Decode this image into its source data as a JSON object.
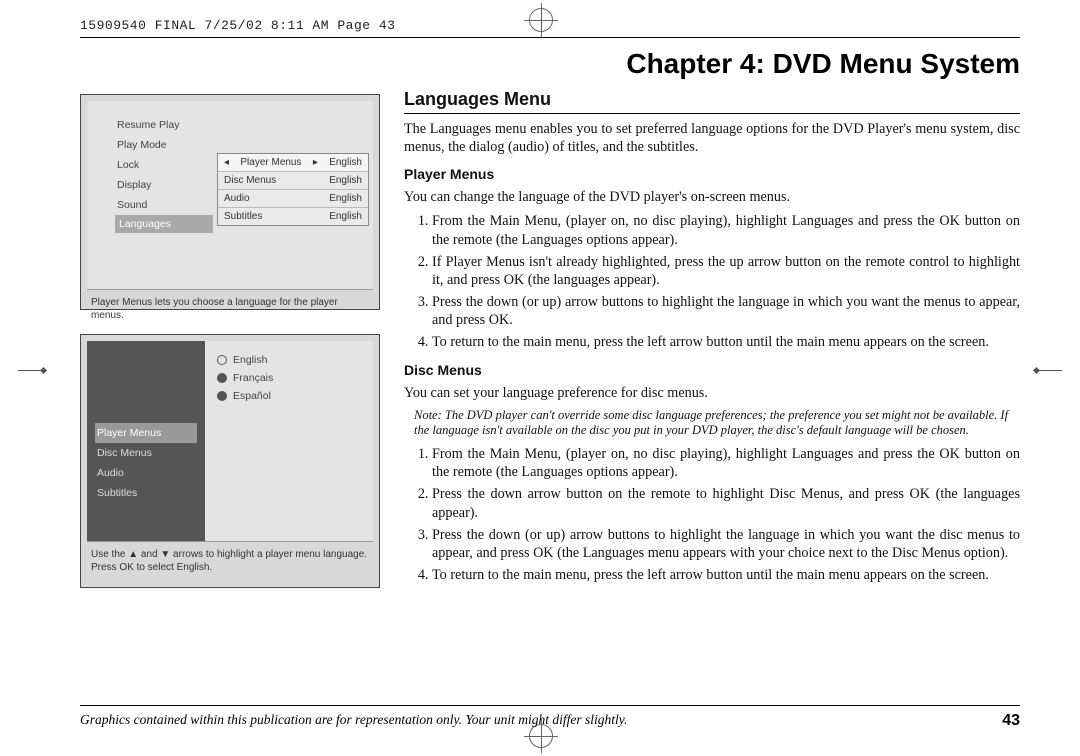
{
  "header_strip": "15909540 FINAL  7/25/02  8:11 AM  Page 43",
  "chapter_title": "Chapter 4: DVD Menu System",
  "section_title": "Languages Menu",
  "intro": "The Languages menu enables you to set preferred language options for the DVD Player's menu system, disc menus, the dialog (audio) of titles, and the subtitles.",
  "player_menus_title": "Player Menus",
  "player_menus_intro": "You can change the language of the DVD player's on-screen menus.",
  "player_steps": {
    "s1": "From the Main Menu, (player on, no disc playing), highlight Languages and press the OK button on the remote (the Languages options appear).",
    "s2": "If Player Menus isn't already highlighted, press the up arrow button on the remote control to highlight it, and press OK (the languages appear).",
    "s3": "Press the down (or up) arrow buttons to highlight the language in which you want the menus to appear, and press OK.",
    "s4": "To return to the main menu, press the left arrow button until the main menu appears on the screen."
  },
  "disc_menus_title": "Disc Menus",
  "disc_menus_intro": "You can set your language preference for disc menus.",
  "disc_note": "Note: The DVD player can't override some disc language preferences; the preference you set might not be available. If the language isn't available on the disc you put in your DVD player, the disc's default language will be chosen.",
  "disc_steps": {
    "s1": "From the Main Menu, (player on, no disc playing), highlight Languages and press the OK button on the remote (the Languages options appear).",
    "s2": "Press the down arrow button on the remote to highlight Disc Menus, and press OK (the languages appear).",
    "s3": "Press the down (or up) arrow buttons to highlight the language in which you want the disc menus to appear, and press OK (the Languages menu appears with your choice next to the Disc Menus option).",
    "s4": "To return to the main menu, press the left arrow button until the main menu appears on the screen."
  },
  "footer_text": "Graphics contained within this publication are for representation only. Your unit might differ slightly.",
  "page_number": "43",
  "shot1": {
    "menu": {
      "m1": "Resume Play",
      "m2": "Play Mode",
      "m3": "Lock",
      "m4": "Display",
      "m5": "Sound",
      "m6": "Languages"
    },
    "sub": {
      "r1l": "Player Menus",
      "r1r": "English",
      "r2l": "Disc Menus",
      "r2r": "English",
      "r3l": "Audio",
      "r3r": "English",
      "r4l": "Subtitles",
      "r4r": "English"
    },
    "caption": "Player Menus lets you choose a language for the player menus."
  },
  "shot2": {
    "sidebar": {
      "i1": "Player Menus",
      "i2": "Disc Menus",
      "i3": "Audio",
      "i4": "Subtitles"
    },
    "langs": {
      "l1": "English",
      "l2": "Français",
      "l3": "Español"
    },
    "caption": "Use the ▲ and ▼ arrows to highlight a player menu language. Press OK to select English."
  }
}
